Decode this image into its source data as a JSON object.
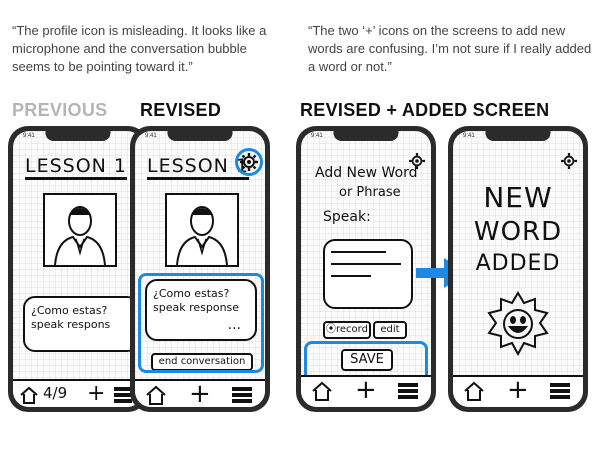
{
  "feedback": {
    "quote_1": "“The profile icon is misleading. It looks like a microphone and the conversation bubble seems to be pointing toward it.”",
    "quote_2": "“The two ‘+’ icons on the screens to add new words are confusing. I’m not sure if I really added a word or not.”"
  },
  "labels": {
    "previous": "PREVIOUS",
    "revised": "REVISED",
    "revised_added": "REVISED + ADDED SCREEN"
  },
  "colors": {
    "highlight": "#1e88e5",
    "previous_label": "#b5b5b5",
    "phone_frame": "#2b2b2b"
  },
  "screens": {
    "previous": {
      "title": "LESSON 1",
      "bubble_text": "¿Como estas?\nspeak respons",
      "tab_label": "4/9",
      "tab_plus": "+"
    },
    "revised": {
      "title": "LESSON 1",
      "bubble_text": "¿Como estas?\nspeak response",
      "bubble_ellipsis": "...",
      "end_button": "end conversation",
      "tab_plus": "+"
    },
    "add_word": {
      "title_line1": "Add New Word",
      "title_line2": "or Phrase",
      "speak_label": "Speak:",
      "record_button": "⦿record",
      "edit_button": "edit",
      "save_button": "SAVE",
      "tab_plus": "+"
    },
    "word_added": {
      "line1": "NEW",
      "line2": "WORD",
      "line3": "ADDED",
      "tab_plus": "+"
    }
  },
  "status_time": "9:41"
}
